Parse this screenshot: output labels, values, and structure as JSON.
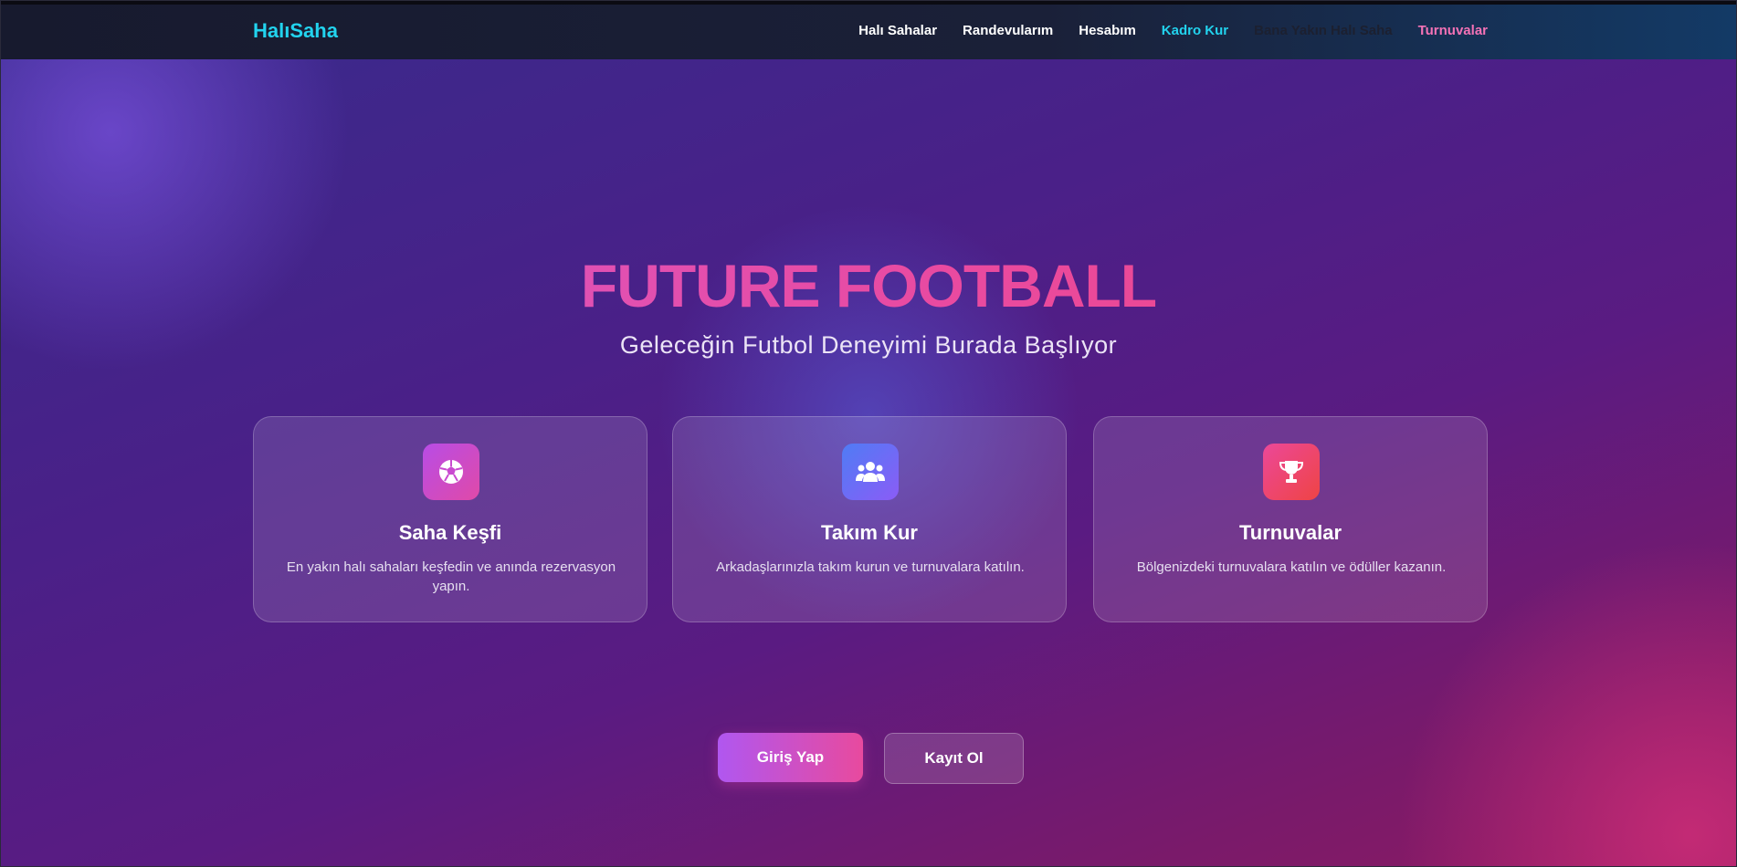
{
  "brand": {
    "name": "HalıSaha",
    "color": "#22d3ee"
  },
  "nav": {
    "items": [
      {
        "label": "Halı Sahalar"
      },
      {
        "label": "Randevularım"
      },
      {
        "label": "Hesabım"
      },
      {
        "label": "Kadro Kur",
        "color": "#22d3ee"
      },
      {
        "label": "Bana Yakın Halı Saha"
      },
      {
        "label": "Turnuvalar",
        "color": "#f472b6"
      }
    ]
  },
  "hero": {
    "title": "FUTURE FOOTBALL",
    "subtitle": "Geleceğin Futbol Deneyimi Burada Başlıyor"
  },
  "features": [
    {
      "icon": "soccer-ball-icon",
      "title": "Saha Keşfi",
      "description": "En yakın halı sahaları keşfedin ve anında rezervasyon yapın.",
      "accent": "#c046e0"
    },
    {
      "icon": "users-icon",
      "title": "Takım Kur",
      "description": "Arkadaşlarınızla takım kurun ve turnuvalara katılın.",
      "accent": "#5b6cf5"
    },
    {
      "icon": "trophy-icon",
      "title": "Turnuvalar",
      "description": "Bölgenizdeki turnuvalara katılın ve ödüller kazanın.",
      "accent": "#f0466a"
    }
  ],
  "actions": {
    "login_label": "Giriş Yap",
    "register_label": "Kayıt Ol"
  }
}
